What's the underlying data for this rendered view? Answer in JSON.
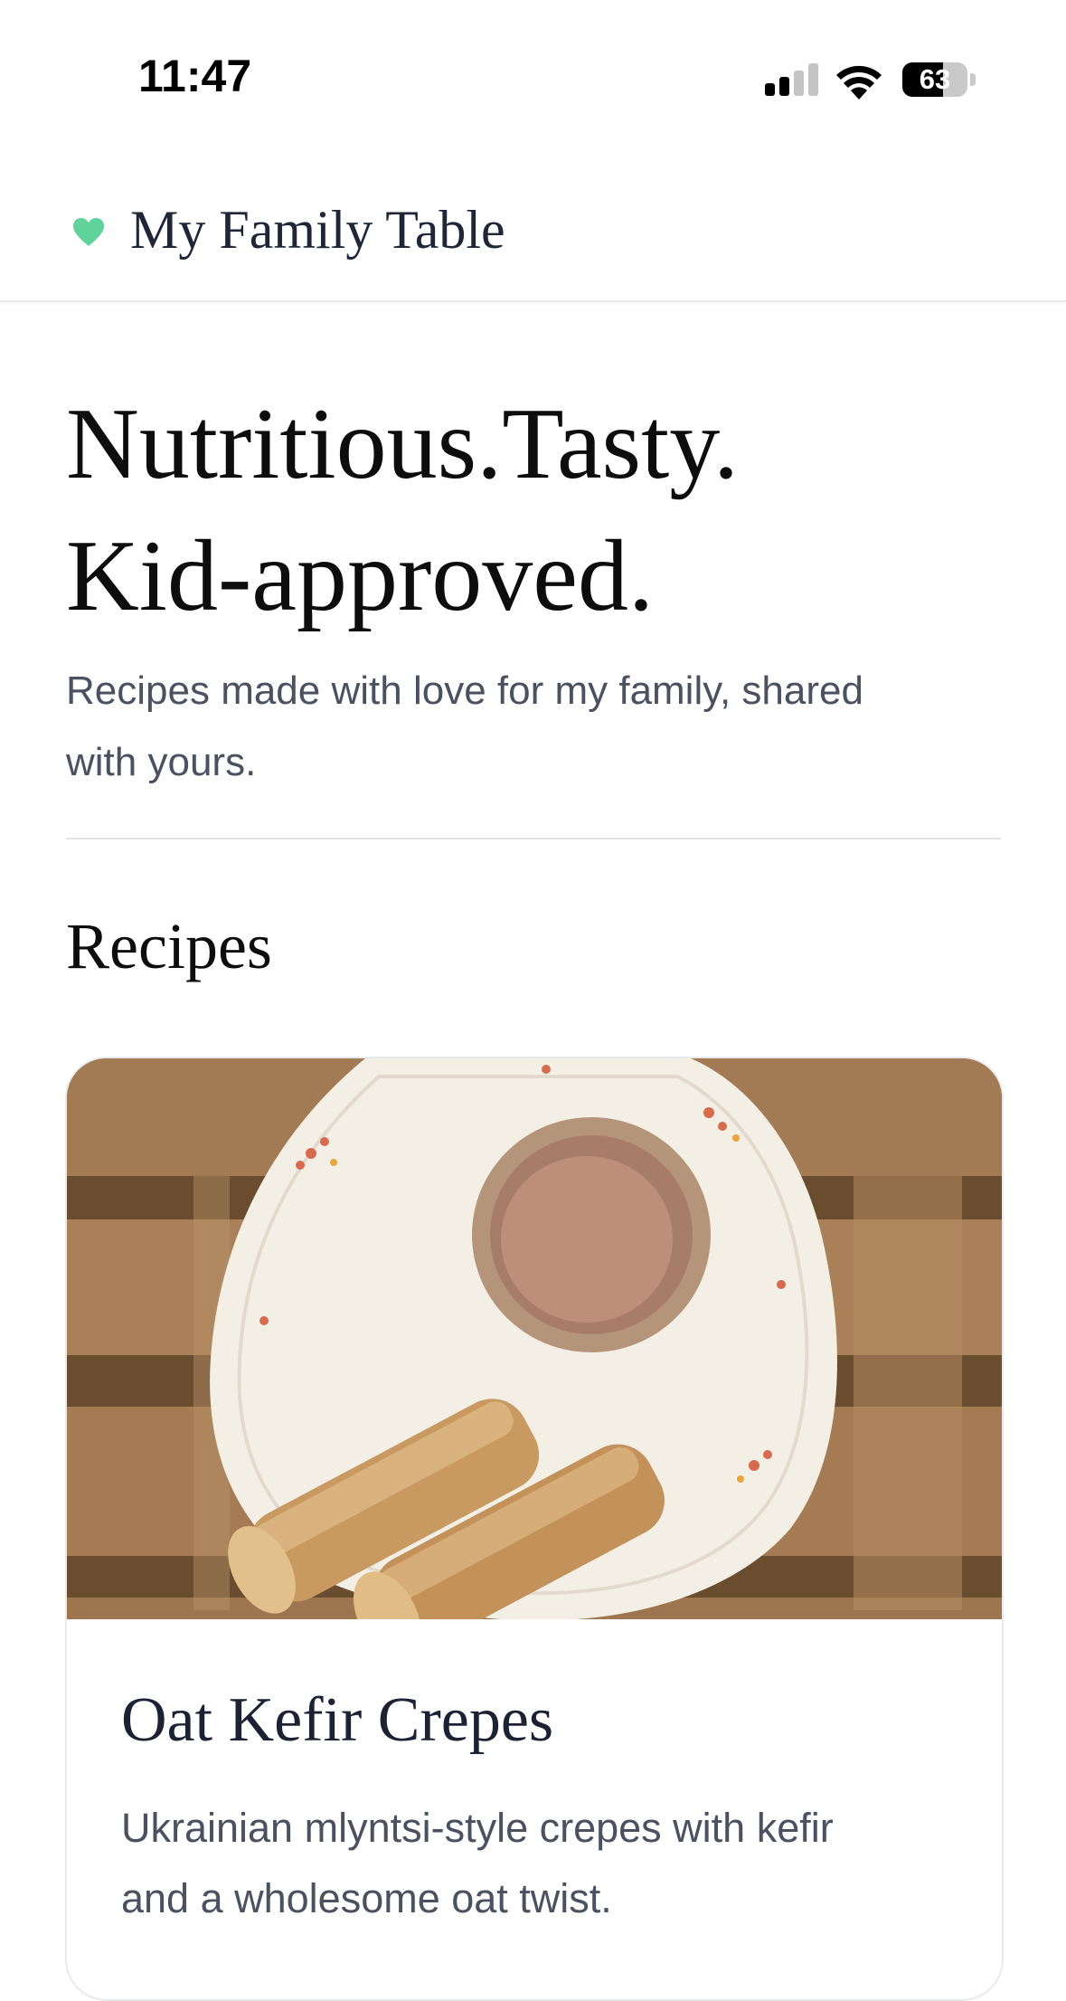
{
  "status_bar": {
    "time": "11:47",
    "battery_percent": "63",
    "battery_level": 0.63,
    "signal_bars_active": 2,
    "signal_bars_total": 4
  },
  "header": {
    "logo_icon": "heart-icon",
    "logo_color": "#5fd39a",
    "title": "My Family Table"
  },
  "hero": {
    "title_line1": "Nutritious.Tasty.",
    "title_line2": "Kid-approved.",
    "subtitle_line1": "Recipes made with love for my family, shared",
    "subtitle_line2": "with yours."
  },
  "section": {
    "heading": "Recipes"
  },
  "recipes": [
    {
      "title": "Oat Kefir Crepes",
      "description_line1": "Ukrainian mlyntsi-style crepes with kefir",
      "description_line2": "and a wholesome oat twist."
    }
  ]
}
